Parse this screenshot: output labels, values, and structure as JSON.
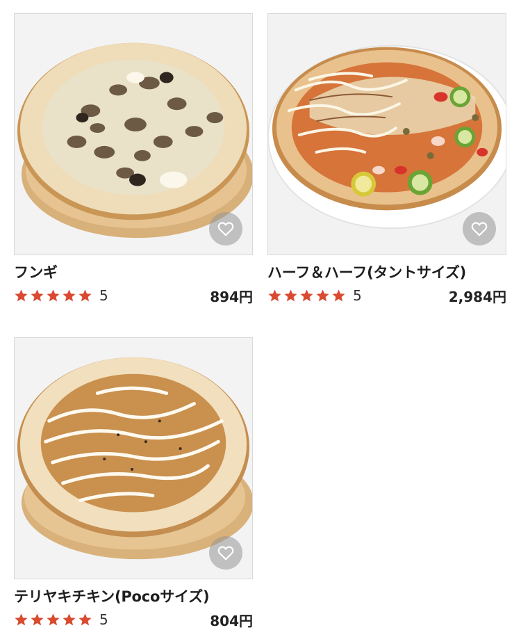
{
  "colors": {
    "star": "#d94a30",
    "border": "#d9d9d9",
    "favorite_bg": "#969696"
  },
  "items": [
    {
      "name": "フンギ",
      "rating": "5",
      "price": "894円",
      "image": "mushroom-pizza-image"
    },
    {
      "name": "ハーフ＆ハーフ(タントサイズ)",
      "rating": "5",
      "price": "2,984円",
      "image": "half-and-half-pizza-image"
    },
    {
      "name": "テリヤキチキン(Pocoサイズ)",
      "rating": "5",
      "price": "804円",
      "image": "teriyaki-chicken-pizza-image"
    }
  ]
}
